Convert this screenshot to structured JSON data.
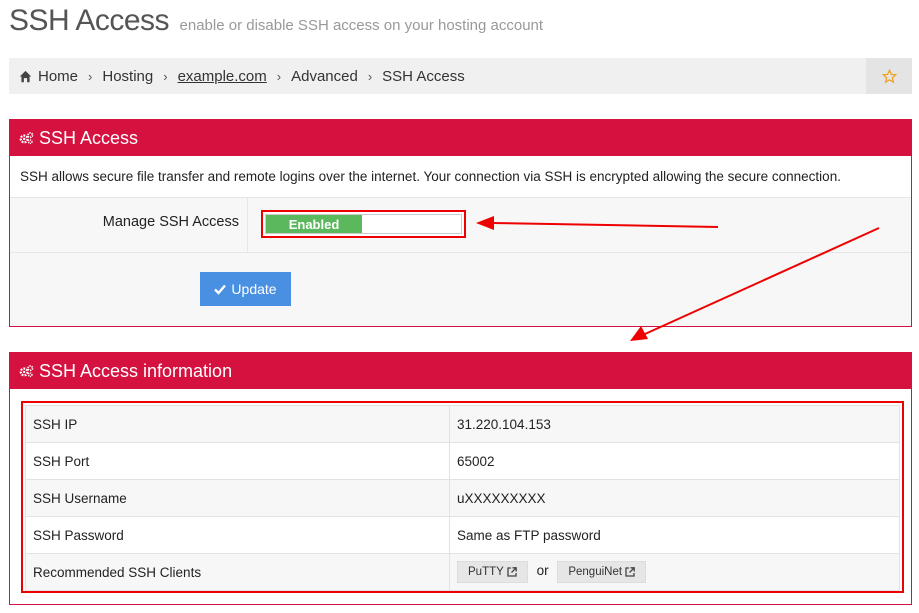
{
  "header": {
    "title": "SSH Access",
    "subtitle": "enable or disable SSH access on your hosting account"
  },
  "breadcrumb": {
    "items": [
      {
        "label": "Home",
        "icon": "home-icon"
      },
      {
        "label": "Hosting"
      },
      {
        "label": "example.com",
        "link": true
      },
      {
        "label": "Advanced"
      },
      {
        "label": "SSH Access"
      }
    ],
    "favorite_icon": "star-outline-icon"
  },
  "panel1": {
    "heading": "SSH Access",
    "description": "SSH allows secure file transfer and remote logins over the internet. Your connection via SSH is encrypted allowing the secure connection.",
    "manage_label": "Manage SSH Access",
    "toggle_state": "Enabled",
    "update_label": "Update"
  },
  "panel2": {
    "heading": "SSH Access information",
    "rows": [
      {
        "key": "SSH IP",
        "value": "31.220.104.153"
      },
      {
        "key": "SSH Port",
        "value": "65002"
      },
      {
        "key": "SSH Username",
        "value": "uXXXXXXXXX"
      },
      {
        "key": "SSH Password",
        "value": "Same as FTP password"
      },
      {
        "key": "Recommended SSH Clients",
        "value": ""
      }
    ],
    "clients": [
      "PuTTY",
      "PenguiNet"
    ],
    "or_text": "or"
  },
  "colors": {
    "accent": "#d51140",
    "enabled": "#5cb85c",
    "button": "#4a90e2",
    "annotation": "#e00000"
  }
}
